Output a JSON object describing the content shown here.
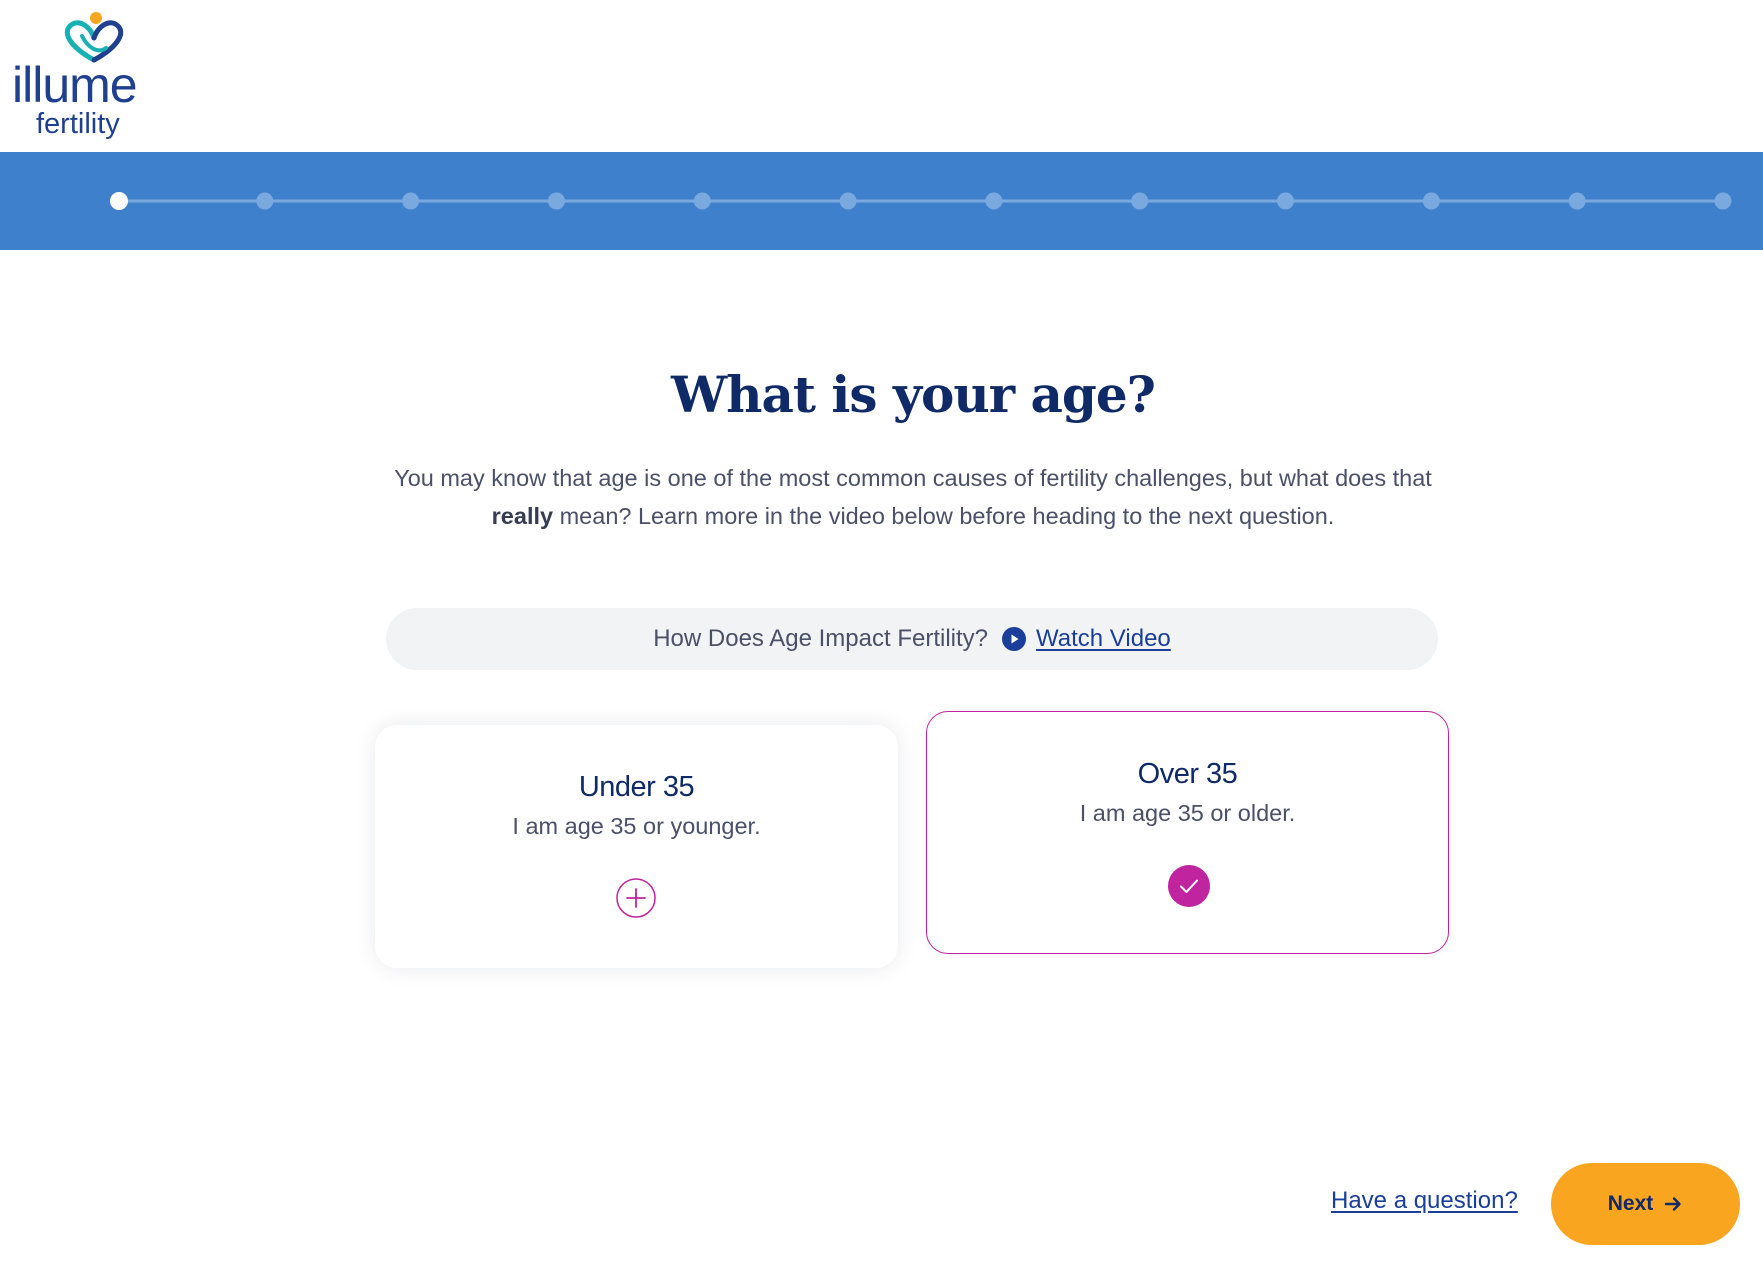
{
  "brand": {
    "name": "illume",
    "subtitle": "fertility",
    "colors": {
      "navy": "#0f2a66",
      "blue": "#3f80cd",
      "teal": "#17b1b4",
      "orange": "#f9a51f",
      "magenta": "#c0249f"
    }
  },
  "progress": {
    "total_steps": 12,
    "current_step": 1
  },
  "question": {
    "title": "What is your age?",
    "intro_before": "You may know that age is one of the most common causes of fertility challenges, but what does that ",
    "intro_bold": "really",
    "intro_after": " mean? Learn more in the video below before heading to the next question."
  },
  "video": {
    "question": "How Does Age Impact Fertility?",
    "link_label": "Watch Video",
    "icon": "play-circle-icon"
  },
  "options": [
    {
      "title": "Under 35",
      "description": "I am age 35 or younger.",
      "selected": false,
      "icon": "plus-circle-icon"
    },
    {
      "title": "Over 35",
      "description": "I am age 35 or older.",
      "selected": true,
      "icon": "check-circle-icon"
    }
  ],
  "footer": {
    "help_label": "Have a question?",
    "next_label": "Next",
    "next_icon": "arrow-right-icon"
  }
}
